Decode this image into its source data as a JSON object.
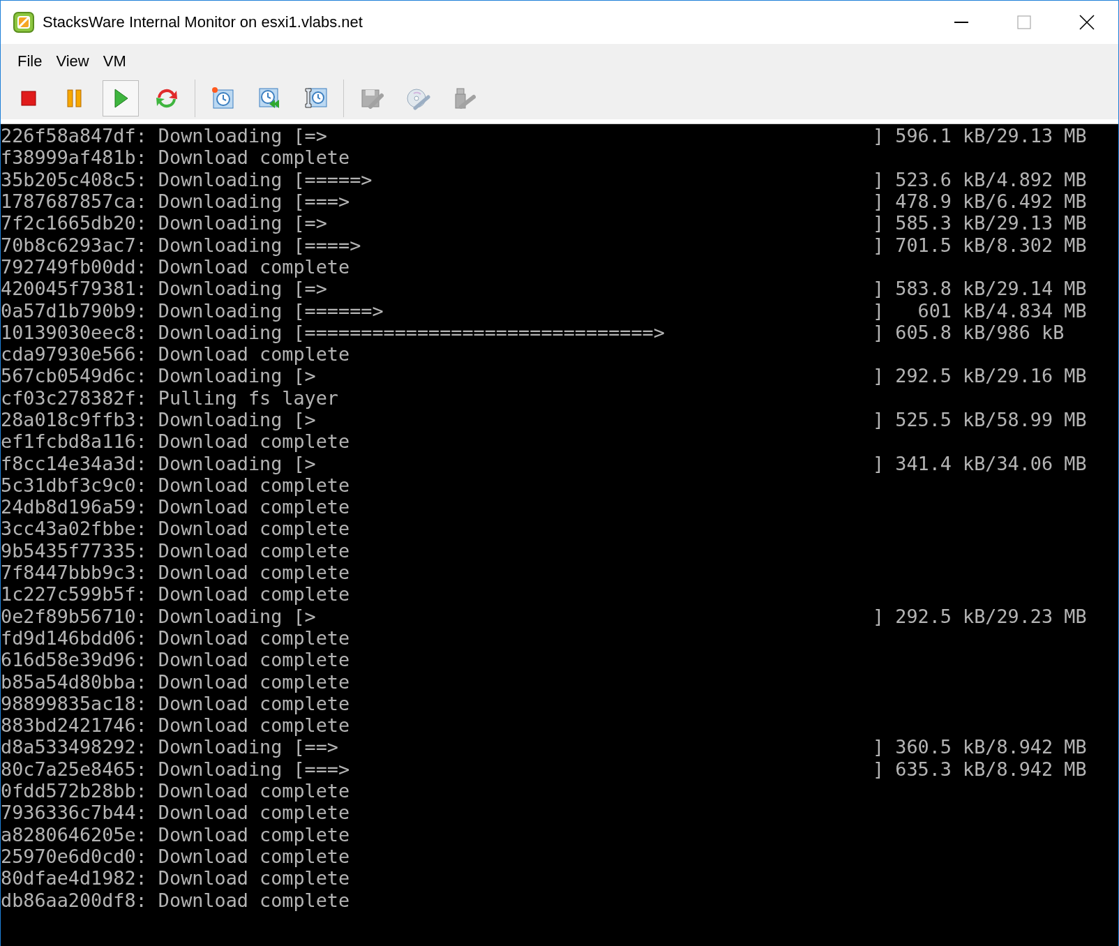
{
  "window": {
    "title": "StacksWare Internal Monitor on esxi1.vlabs.net"
  },
  "menu": [
    {
      "label": "File"
    },
    {
      "label": "View"
    },
    {
      "label": "VM"
    }
  ],
  "toolbar": [
    {
      "kind": "power-off",
      "selected": false,
      "disabled": false
    },
    {
      "kind": "suspend",
      "selected": false,
      "disabled": false
    },
    {
      "kind": "power-on",
      "selected": true,
      "disabled": false
    },
    {
      "kind": "reset",
      "selected": false,
      "disabled": false
    },
    {
      "kind": "snapshot-take",
      "selected": false,
      "disabled": false
    },
    {
      "kind": "snapshot-revert",
      "selected": false,
      "disabled": false
    },
    {
      "kind": "snapshot-manage",
      "selected": false,
      "disabled": false
    },
    {
      "kind": "edit-settings",
      "selected": false,
      "disabled": true
    },
    {
      "kind": "cd-dvd",
      "selected": false,
      "disabled": true
    },
    {
      "kind": "usb",
      "selected": false,
      "disabled": true
    }
  ],
  "console": {
    "lines": [
      {
        "text": "226f58a847df: Downloading [=>",
        "progress": "] 596.1 kB/29.13 MB"
      },
      {
        "text": "f38999af481b: Download complete"
      },
      {
        "text": "35b205c408c5: Downloading [=====>",
        "progress": "] 523.6 kB/4.892 MB"
      },
      {
        "text": "1787687857ca: Downloading [===>",
        "progress": "] 478.9 kB/6.492 MB"
      },
      {
        "text": "7f2c1665db20: Downloading [=>",
        "progress": "] 585.3 kB/29.13 MB"
      },
      {
        "text": "70b8c6293ac7: Downloading [====>",
        "progress": "] 701.5 kB/8.302 MB"
      },
      {
        "text": "792749fb00dd: Download complete"
      },
      {
        "text": "420045f79381: Downloading [=>",
        "progress": "] 583.8 kB/29.14 MB"
      },
      {
        "text": "0a57d1b790b9: Downloading [======>",
        "progress": "]   601 kB/4.834 MB"
      },
      {
        "text": "10139030eec8: Downloading [===============================>",
        "progress": "] 605.8 kB/986 kB"
      },
      {
        "text": "cda97930e566: Download complete"
      },
      {
        "text": "567cb0549d6c: Downloading [>",
        "progress": "] 292.5 kB/29.16 MB"
      },
      {
        "text": "cf03c278382f: Pulling fs layer"
      },
      {
        "text": "28a018c9ffb3: Downloading [>",
        "progress": "] 525.5 kB/58.99 MB"
      },
      {
        "text": "ef1fcbd8a116: Download complete"
      },
      {
        "text": "f8cc14e34a3d: Downloading [>",
        "progress": "] 341.4 kB/34.06 MB"
      },
      {
        "text": "5c31dbf3c9c0: Download complete"
      },
      {
        "text": "24db8d196a59: Download complete"
      },
      {
        "text": "3cc43a02fbbe: Download complete"
      },
      {
        "text": "9b5435f77335: Download complete"
      },
      {
        "text": "7f8447bbb9c3: Download complete"
      },
      {
        "text": "1c227c599b5f: Download complete"
      },
      {
        "text": "0e2f89b56710: Downloading [>",
        "progress": "] 292.5 kB/29.23 MB"
      },
      {
        "text": "fd9d146bdd06: Download complete"
      },
      {
        "text": "616d58e39d96: Download complete"
      },
      {
        "text": "b85a54d80bba: Download complete"
      },
      {
        "text": "98899835ac18: Download complete"
      },
      {
        "text": "883bd2421746: Download complete"
      },
      {
        "text": "d8a533498292: Downloading [==>",
        "progress": "] 360.5 kB/8.942 MB"
      },
      {
        "text": "80c7a25e8465: Downloading [===>",
        "progress": "] 635.3 kB/8.942 MB"
      },
      {
        "text": "0fdd572b28bb: Download complete"
      },
      {
        "text": "7936336c7b44: Download complete"
      },
      {
        "text": "a8280646205e: Download complete"
      },
      {
        "text": "25970e6d0cd0: Download complete"
      },
      {
        "text": "80dfae4d1982: Download complete"
      },
      {
        "text": "db86aa200df8: Download complete"
      }
    ]
  }
}
